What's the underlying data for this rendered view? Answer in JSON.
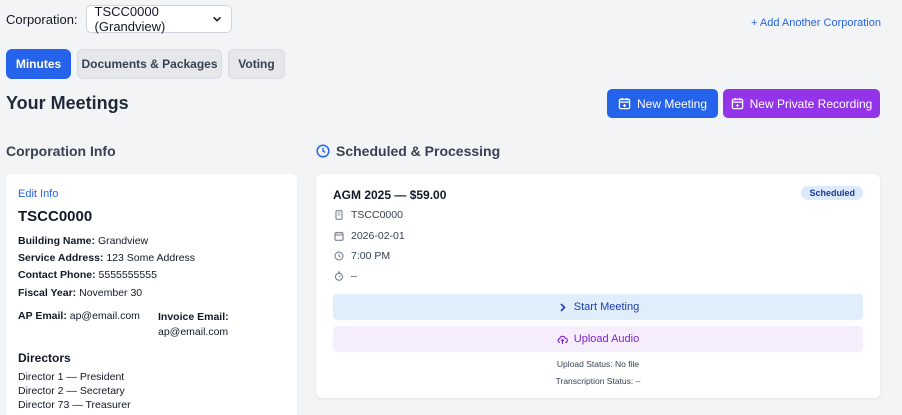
{
  "corporation": {
    "label": "Corporation:",
    "selected": "TSCC0000 (Grandview)",
    "add_link": "+ Add Another Corporation"
  },
  "tabs": [
    {
      "label": "Minutes",
      "active": true
    },
    {
      "label": "Documents & Packages",
      "active": false
    },
    {
      "label": "Voting",
      "active": false
    }
  ],
  "page_title": "Your Meetings",
  "buttons": {
    "new_meeting": "New Meeting",
    "new_private_recording": "New Private Recording"
  },
  "corp_info": {
    "section_title": "Corporation Info",
    "edit_link": "Edit Info",
    "code": "TSCC0000",
    "building_label": "Building Name:",
    "building_value": "Grandview",
    "address_label": "Service Address:",
    "address_value": "123 Some Address",
    "phone_label": "Contact Phone:",
    "phone_value": "5555555555",
    "fiscal_label": "Fiscal Year:",
    "fiscal_value": "November 30",
    "ap_label": "AP Email:",
    "ap_value": "ap@email.com",
    "invoice_label": "Invoice Email:",
    "invoice_value": "ap@email.com",
    "directors_title": "Directors",
    "directors": [
      "Director 1 — President",
      "Director 2 — Secretary",
      "Director 73 — Treasurer"
    ]
  },
  "scheduled": {
    "section_title": "Scheduled & Processing",
    "meeting": {
      "title": "AGM 2025 — $59.00",
      "badge": "Scheduled",
      "corp": "TSCC0000",
      "date": "2026-02-01",
      "time": "7:00 PM",
      "duration": "–",
      "start_label": "Start Meeting",
      "upload_label": "Upload Audio",
      "upload_status": "Upload Status: No file",
      "transcription_status": "Transcription Status: –"
    }
  },
  "colors": {
    "primary": "#2563eb",
    "purple": "#9333ea",
    "badge_bg": "#dbeafe",
    "background": "#f3f4f6"
  }
}
